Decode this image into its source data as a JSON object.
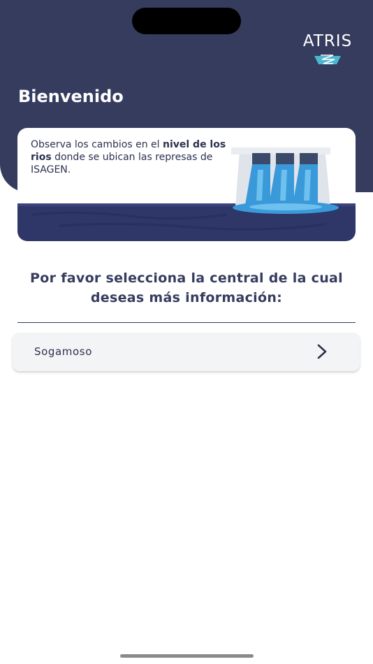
{
  "header": {
    "logo_text": "ATRIS",
    "welcome_title": "Bienvenido",
    "colors": {
      "header_bg": "#353c5e",
      "water": "#3a9ad9"
    }
  },
  "banner": {
    "text_part1": "Observa los cambios en el ",
    "text_bold": "nivel de los rios",
    "text_part2": " donde se ubican las represas de ISAGEN.",
    "illustration": "dam-illustration-icon"
  },
  "main": {
    "prompt": "Por favor selecciona la central de la cual deseas más información:",
    "select": {
      "value": "Sogamoso",
      "icon": "chevron-right-icon"
    }
  }
}
